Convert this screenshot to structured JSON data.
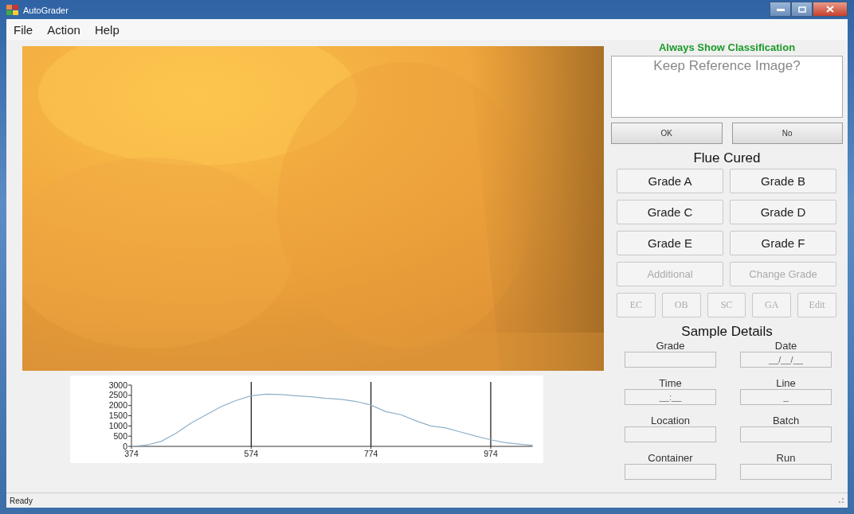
{
  "window": {
    "title": "AutoGrader"
  },
  "menu": [
    "File",
    "Action",
    "Help"
  ],
  "viewer": {
    "kind": "picture"
  },
  "histogram": {
    "chart_data": {
      "type": "line",
      "xlim": [
        374,
        1044
      ],
      "ylim": [
        0,
        3000
      ],
      "xticks": [
        374,
        574,
        774,
        974
      ],
      "yticks": [
        0,
        500,
        1000,
        1500,
        2000,
        2500,
        3000
      ],
      "x": [
        374,
        399,
        424,
        449,
        474,
        499,
        524,
        549,
        574,
        599,
        624,
        649,
        674,
        699,
        724,
        749,
        774,
        799,
        824,
        849,
        874,
        899,
        924,
        949,
        974,
        999,
        1024,
        1044
      ],
      "series": [
        {
          "color": "#8fb0c8",
          "values": [
            0,
            60,
            250,
            650,
            1150,
            1550,
            1950,
            2250,
            2480,
            2560,
            2540,
            2480,
            2430,
            2350,
            2300,
            2200,
            2020,
            1700,
            1550,
            1250,
            1000,
            900,
            700,
            500,
            320,
            180,
            100,
            50
          ]
        }
      ],
      "grid": true
    }
  },
  "classification_toggle": "Always Show Classification",
  "prompt": {
    "text": "Keep Reference Image?",
    "buttons": [
      "OK",
      "No"
    ]
  },
  "flue_cured": {
    "title": "Flue Cured",
    "grade_buttons": [
      {
        "label": "Grade A",
        "disabled": false
      },
      {
        "label": "Grade B",
        "disabled": false
      },
      {
        "label": "Grade C",
        "disabled": false
      },
      {
        "label": "Grade D",
        "disabled": false
      },
      {
        "label": "Grade E",
        "disabled": false
      },
      {
        "label": "Grade F",
        "disabled": false
      },
      {
        "label": "Additional",
        "disabled": true
      },
      {
        "label": "Change Grade",
        "disabled": true
      }
    ],
    "code_buttons": [
      {
        "label": "EC",
        "disabled": true
      },
      {
        "label": "OB",
        "disabled": true
      },
      {
        "label": "SC",
        "disabled": true
      },
      {
        "label": "GA",
        "disabled": true
      },
      {
        "label": "Edit",
        "disabled": true
      }
    ]
  },
  "sample_details": {
    "title": "Sample Details",
    "fields": [
      {
        "label": "Grade"
      },
      {
        "label": "Date",
        "value": "__/__/__"
      },
      {
        "label": "Time",
        "value": "__:__"
      },
      {
        "label": "Line",
        "value": "_"
      },
      {
        "label": "Location"
      },
      {
        "label": "Batch"
      },
      {
        "label": "Container"
      },
      {
        "label": "Run"
      }
    ]
  },
  "status_bar": "Ready"
}
